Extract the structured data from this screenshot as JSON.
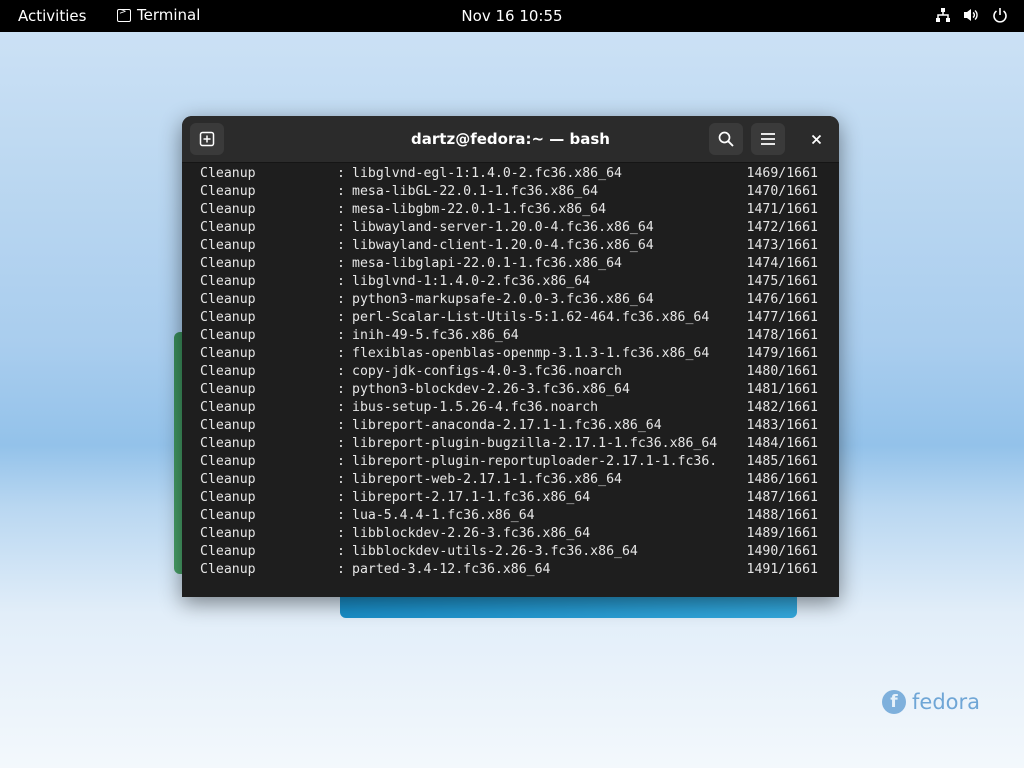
{
  "topbar": {
    "activities": "Activities",
    "app_name": "Terminal",
    "clock": "Nov 16  10:55",
    "icons": [
      "network-icon",
      "volume-icon",
      "power-icon"
    ]
  },
  "window": {
    "title": "dartz@fedora:~ — bash",
    "buttons": {
      "new_tab": "new-tab-icon",
      "search": "search-icon",
      "menu": "hamburger-menu-icon",
      "close": "close-icon"
    }
  },
  "terminal": {
    "lines": [
      {
        "action": "Cleanup",
        "colon": ":",
        "pkg": "libglvnd-egl-1:1.4.0-2.fc36.x86_64",
        "count": "1469/1661"
      },
      {
        "action": "Cleanup",
        "colon": ":",
        "pkg": "mesa-libGL-22.0.1-1.fc36.x86_64",
        "count": "1470/1661"
      },
      {
        "action": "Cleanup",
        "colon": ":",
        "pkg": "mesa-libgbm-22.0.1-1.fc36.x86_64",
        "count": "1471/1661"
      },
      {
        "action": "Cleanup",
        "colon": ":",
        "pkg": "libwayland-server-1.20.0-4.fc36.x86_64",
        "count": "1472/1661"
      },
      {
        "action": "Cleanup",
        "colon": ":",
        "pkg": "libwayland-client-1.20.0-4.fc36.x86_64",
        "count": "1473/1661"
      },
      {
        "action": "Cleanup",
        "colon": ":",
        "pkg": "mesa-libglapi-22.0.1-1.fc36.x86_64",
        "count": "1474/1661"
      },
      {
        "action": "Cleanup",
        "colon": ":",
        "pkg": "libglvnd-1:1.4.0-2.fc36.x86_64",
        "count": "1475/1661"
      },
      {
        "action": "Cleanup",
        "colon": ":",
        "pkg": "python3-markupsafe-2.0.0-3.fc36.x86_64",
        "count": "1476/1661"
      },
      {
        "action": "Cleanup",
        "colon": ":",
        "pkg": "perl-Scalar-List-Utils-5:1.62-464.fc36.x86_64",
        "count": "1477/1661"
      },
      {
        "action": "Cleanup",
        "colon": ":",
        "pkg": "inih-49-5.fc36.x86_64",
        "count": "1478/1661"
      },
      {
        "action": "Cleanup",
        "colon": ":",
        "pkg": "flexiblas-openblas-openmp-3.1.3-1.fc36.x86_64",
        "count": "1479/1661"
      },
      {
        "action": "Cleanup",
        "colon": ":",
        "pkg": "copy-jdk-configs-4.0-3.fc36.noarch",
        "count": "1480/1661"
      },
      {
        "action": "Cleanup",
        "colon": ":",
        "pkg": "python3-blockdev-2.26-3.fc36.x86_64",
        "count": "1481/1661"
      },
      {
        "action": "Cleanup",
        "colon": ":",
        "pkg": "ibus-setup-1.5.26-4.fc36.noarch",
        "count": "1482/1661"
      },
      {
        "action": "Cleanup",
        "colon": ":",
        "pkg": "libreport-anaconda-2.17.1-1.fc36.x86_64",
        "count": "1483/1661"
      },
      {
        "action": "Cleanup",
        "colon": ":",
        "pkg": "libreport-plugin-bugzilla-2.17.1-1.fc36.x86_64",
        "count": "1484/1661"
      },
      {
        "action": "Cleanup",
        "colon": ":",
        "pkg": "libreport-plugin-reportuploader-2.17.1-1.fc36.",
        "count": "1485/1661"
      },
      {
        "action": "Cleanup",
        "colon": ":",
        "pkg": "libreport-web-2.17.1-1.fc36.x86_64",
        "count": "1486/1661"
      },
      {
        "action": "Cleanup",
        "colon": ":",
        "pkg": "libreport-2.17.1-1.fc36.x86_64",
        "count": "1487/1661"
      },
      {
        "action": "Cleanup",
        "colon": ":",
        "pkg": "lua-5.4.4-1.fc36.x86_64",
        "count": "1488/1661"
      },
      {
        "action": "Cleanup",
        "colon": ":",
        "pkg": "libblockdev-2.26-3.fc36.x86_64",
        "count": "1489/1661"
      },
      {
        "action": "Cleanup",
        "colon": ":",
        "pkg": "libblockdev-utils-2.26-3.fc36.x86_64",
        "count": "1490/1661"
      },
      {
        "action": "Cleanup",
        "colon": ":",
        "pkg": "parted-3.4-12.fc36.x86_64",
        "count": "1491/1661"
      }
    ]
  },
  "desktop": {
    "logo_text": "fedora",
    "logo_mark": "f"
  }
}
